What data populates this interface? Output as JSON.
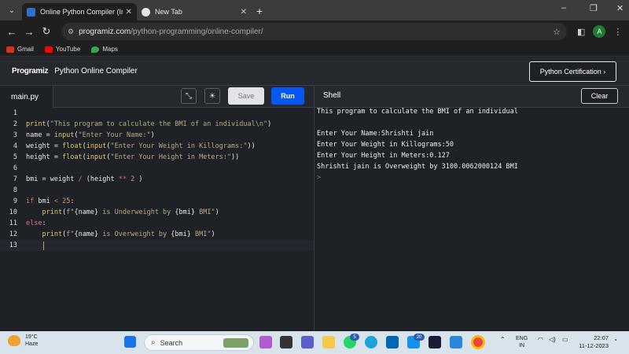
{
  "browser": {
    "tabs": [
      {
        "title": "Online Python Compiler (Interp",
        "close": "✕",
        "favicon_color": "#2f6fd0"
      },
      {
        "title": "New Tab",
        "close": "✕",
        "favicon_color": "#e6e6e6"
      }
    ],
    "new_tab": "+",
    "window_controls": {
      "minimize": "–",
      "restore": "❐",
      "close": "✕"
    },
    "nav": {
      "back": "←",
      "forward": "→",
      "reload": "↻"
    },
    "url_host": "programiz.com",
    "url_path": "/python-programming/online-compiler/",
    "avatar_letter": "A",
    "bookmarks": [
      {
        "label": "Gmail",
        "color": "#d93025"
      },
      {
        "label": "YouTube",
        "color": "#ff0000"
      },
      {
        "label": "Maps",
        "color": "#34a853"
      }
    ]
  },
  "app": {
    "logo": "Programiz",
    "title": "Python Online Compiler",
    "cert_button": "Python Certification ›"
  },
  "editor": {
    "file_tab": "main.py",
    "save_label": "Save",
    "run_label": "Run",
    "line_numbers": [
      "1",
      "2",
      "3",
      "4",
      "5",
      "6",
      "7",
      "8",
      "9",
      "10",
      "11",
      "12",
      "13"
    ]
  },
  "shell": {
    "title": "Shell",
    "clear_label": "Clear",
    "output": [
      "This program to calculate the BMI of an individual",
      "",
      "Enter Your Name:Shrishti jain",
      "Enter Your Weight in Killograms:50",
      "Enter Your Height in Meters:0.127",
      "Shrishti jain is Overweight by 3100.0062000124 BMI"
    ],
    "prompt": ">"
  },
  "taskbar": {
    "temp": "19°C",
    "condition": "Haze",
    "search_placeholder": "Search",
    "lang_top": "ENG",
    "lang_bottom": "IN",
    "time": "22:07",
    "date": "11-12-2023",
    "badge_whatsapp": "5",
    "badge_store": "20"
  },
  "colors": {
    "accent_run": "#0556f3",
    "keyword": "#e06c75",
    "function": "#e0c66a",
    "string": "#b9a87c"
  }
}
